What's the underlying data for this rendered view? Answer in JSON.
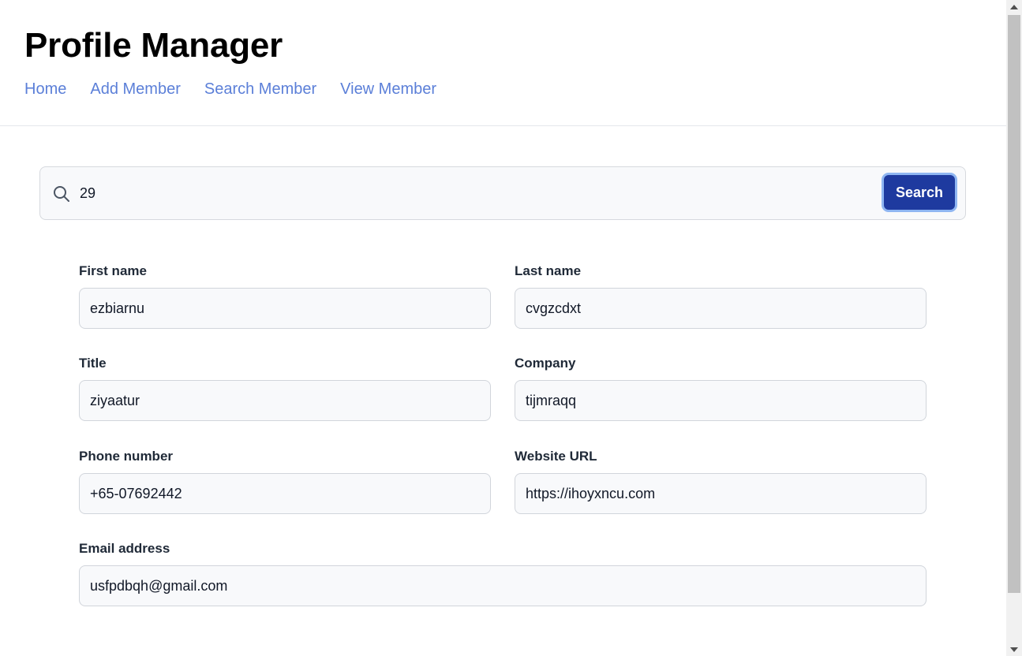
{
  "header": {
    "title": "Profile Manager",
    "nav": [
      "Home",
      "Add Member",
      "Search Member",
      "View Member"
    ]
  },
  "search": {
    "value": "29",
    "button_label": "Search",
    "icon": "search-icon"
  },
  "form": {
    "first_name": {
      "label": "First name",
      "value": "ezbiarnu"
    },
    "last_name": {
      "label": "Last name",
      "value": "cvgzcdxt"
    },
    "title": {
      "label": "Title",
      "value": "ziyaatur"
    },
    "company": {
      "label": "Company",
      "value": "tijmraqq"
    },
    "phone": {
      "label": "Phone number",
      "value": "+65-07692442"
    },
    "website": {
      "label": "Website URL",
      "value": "https://ihoyxncu.com"
    },
    "email": {
      "label": "Email address",
      "value": "usfpdbqh@gmail.com"
    }
  },
  "colors": {
    "link": "#5b7fd8",
    "button": "#1e3a9f",
    "button_ring": "#8fb6f2",
    "input_bg": "#f8f9fb"
  }
}
